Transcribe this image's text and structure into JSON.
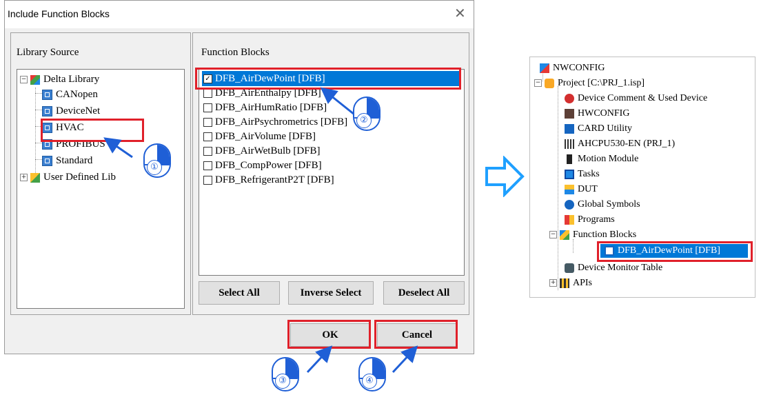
{
  "dialog": {
    "title": "Include Function Blocks",
    "close_glyph": "✕"
  },
  "library_source": {
    "heading": "Library Source",
    "root": "Delta Library",
    "items": [
      "CANopen",
      "DeviceNet",
      "HVAC",
      "PROFIBUS",
      "Standard"
    ],
    "user_defined": "User Defined Lib",
    "selected": "HVAC"
  },
  "function_blocks": {
    "heading": "Function Blocks",
    "items": [
      {
        "label": "DFB_AirDewPoint [DFB]",
        "checked": true
      },
      {
        "label": "DFB_AirEnthalpy [DFB]",
        "checked": false
      },
      {
        "label": "DFB_AirHumRatio [DFB]",
        "checked": false
      },
      {
        "label": "DFB_AirPsychrometrics [DFB]",
        "checked": false
      },
      {
        "label": "DFB_AirVolume [DFB]",
        "checked": false
      },
      {
        "label": "DFB_AirWetBulb [DFB]",
        "checked": false
      },
      {
        "label": "DFB_CompPower [DFB]",
        "checked": false
      },
      {
        "label": "DFB_RefrigerantP2T [DFB]",
        "checked": false
      }
    ],
    "check_glyph": "✓"
  },
  "buttons": {
    "select_all": "Select All",
    "inverse_select": "Inverse Select",
    "deselect_all": "Deselect All",
    "ok": "OK",
    "cancel": "Cancel"
  },
  "step_markers": [
    "①",
    "②",
    "③",
    "④"
  ],
  "project_tree": {
    "top": "NWCONFIG",
    "project": "Project [C:\\PRJ_1.isp]",
    "children": [
      "Device Comment & Used Device",
      "HWCONFIG",
      "CARD Utility",
      "AHCPU530-EN  (PRJ_1)",
      "Motion Module",
      "Tasks",
      "DUT",
      "Global Symbols",
      "Programs",
      "Function Blocks",
      "DFB_AirDewPoint [DFB]",
      "Device Monitor Table",
      "APIs"
    ]
  },
  "colors": {
    "highlight": "#0078d7",
    "annotation_red": "#e0202a",
    "annotation_blue": "#1f5fd6"
  }
}
